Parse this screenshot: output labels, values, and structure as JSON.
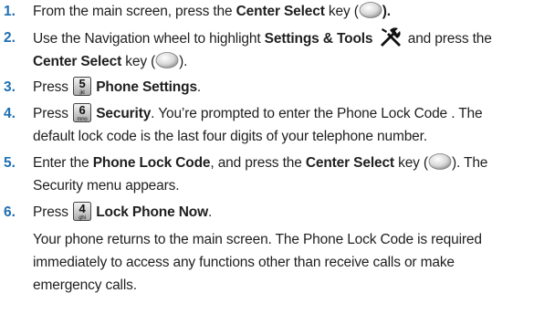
{
  "steps": [
    {
      "number": "1.",
      "text_a": "From the main screen, press the ",
      "bold_a": "Center Select",
      "text_b": " key (",
      "bold_end": ")."
    },
    {
      "number": "2.",
      "text_a": "Use the Navigation wheel to highlight ",
      "bold_a": "Settings & Tools",
      "text_b": " and press the",
      "bold_b": "Center Select",
      "text_c": " key (",
      "text_d": ")."
    },
    {
      "number": "3.",
      "text_a": "Press ",
      "key_digit": "5",
      "key_letters": "jkl",
      "bold_a": "Phone Settings",
      "text_b": "."
    },
    {
      "number": "4.",
      "text_a": "Press ",
      "key_digit": "6",
      "key_letters": "mno",
      "bold_a": "Security",
      "text_b": ". You’re prompted to enter the Phone Lock Code . The",
      "line2": "default lock code is the last four digits of your telephone number."
    },
    {
      "number": "5.",
      "text_a": "Enter the ",
      "bold_a": "Phone Lock Code",
      "text_b": ", and press the ",
      "bold_b": "Center Select",
      "text_c": " key (",
      "text_d": "). The",
      "line2": "Security menu appears."
    },
    {
      "number": "6.",
      "text_a": "Press ",
      "key_digit": "4",
      "key_letters": "ghi",
      "bold_a": "Lock Phone Now",
      "text_b": "."
    }
  ],
  "note_lines": [
    "Your phone returns to the main screen. The Phone Lock Code is required",
    "immediately to access any functions other than receive calls or make",
    "emergency calls."
  ],
  "colors": {
    "number": "#1f6fb4",
    "text": "#1f1f1f",
    "key_face": "#c9c9c9"
  }
}
